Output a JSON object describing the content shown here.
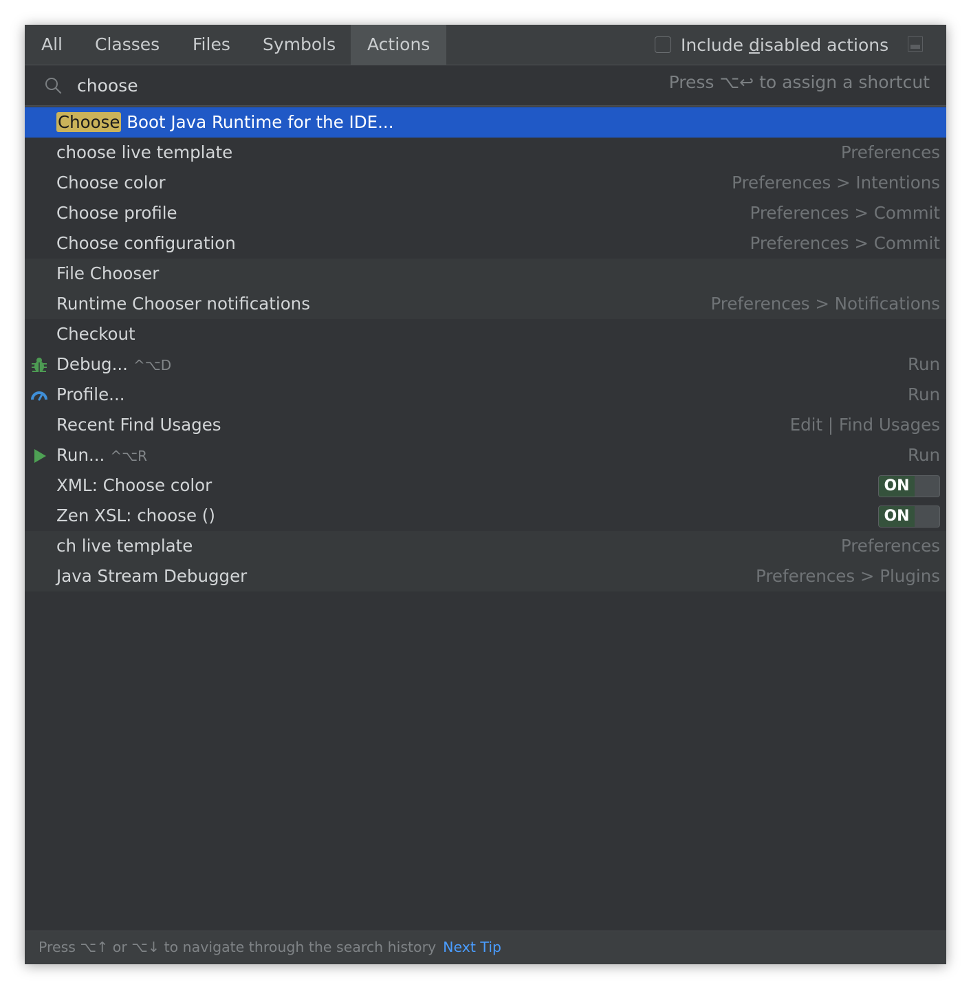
{
  "tabs": [
    {
      "label": "All"
    },
    {
      "label": "Classes"
    },
    {
      "label": "Files"
    },
    {
      "label": "Symbols"
    },
    {
      "label": "Actions"
    }
  ],
  "active_tab": "Actions",
  "include_disabled": {
    "pre": "Include ",
    "mnemonic": "d",
    "post": "isabled actions",
    "checked": false
  },
  "search": {
    "value": "choose",
    "hint": "Press ⌥↩ to assign a shortcut"
  },
  "results": [
    {
      "highlight": "Choose",
      "rest": " Boot Java Runtime for the IDE...",
      "location": "",
      "selected": true
    },
    {
      "name": "choose live template",
      "location": "Preferences"
    },
    {
      "name": "Choose color",
      "location": "Preferences > Intentions"
    },
    {
      "name": "Choose profile",
      "location": "Preferences > Commit"
    },
    {
      "name": "Choose configuration",
      "location": "Preferences > Commit"
    },
    {
      "name": "File Chooser",
      "location": ""
    },
    {
      "name": "Runtime Chooser notifications",
      "location": "Preferences > Notifications"
    },
    {
      "name": "Checkout",
      "location": ""
    },
    {
      "name": "Debug...",
      "shortcut": "^⌥D",
      "location": "Run",
      "icon": "bug-icon"
    },
    {
      "name": "Profile...",
      "shortcut": "",
      "location": "Run",
      "icon": "gauge-icon"
    },
    {
      "name": "Recent Find Usages",
      "location": "Edit | Find Usages"
    },
    {
      "name": "Run...",
      "shortcut": "^⌥R",
      "location": "Run",
      "icon": "play-icon"
    },
    {
      "name": "XML: Choose color",
      "toggle": "ON"
    },
    {
      "name": "Zen XSL: choose ()",
      "toggle": "ON"
    },
    {
      "name": "ch live template",
      "location": "Preferences"
    },
    {
      "name": "Java Stream Debugger",
      "location": "Preferences > Plugins"
    }
  ],
  "status": {
    "text": "Press ⌥↑ or ⌥↓ to navigate through the search history",
    "link": "Next Tip"
  },
  "colors": {
    "selection": "#2059c6",
    "match_highlight": "#cbb35a",
    "link": "#4a9dff",
    "toggle_on": "#35523c"
  }
}
